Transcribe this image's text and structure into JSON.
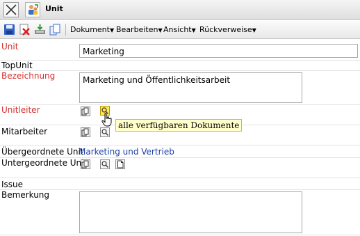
{
  "window": {
    "title": "Unit"
  },
  "menus": [
    {
      "label": "Dokument"
    },
    {
      "label": "Bearbeiten"
    },
    {
      "label": "Ansicht"
    },
    {
      "label": "Rückverweise"
    }
  ],
  "form": {
    "unit": {
      "label": "Unit",
      "value": "Marketing"
    },
    "topunit": {
      "label": "TopUnit"
    },
    "bezeichnung": {
      "label": "Bezeichnung",
      "value": "Marketing und Öffentlichkeitsarbeit"
    },
    "unitleiter": {
      "label": "Unitleiter"
    },
    "mitarbeiter": {
      "label": "Mitarbeiter"
    },
    "uebergeordnete": {
      "label": "Übergeordnete Unit",
      "value": "Marketing und Vertrieb"
    },
    "untergeordnete": {
      "label": "Untergeordnete Unit"
    },
    "issue": {
      "label": "Issue"
    },
    "bemerkung": {
      "label": "Bemerkung",
      "value": ""
    }
  },
  "tooltip": {
    "text": "alle verfügbaren Dokumente"
  },
  "colors": {
    "required_label": "#d23030",
    "link": "#1a3fa6",
    "tooltip_bg": "#ffffcc",
    "active_button": "#ffe75a"
  }
}
